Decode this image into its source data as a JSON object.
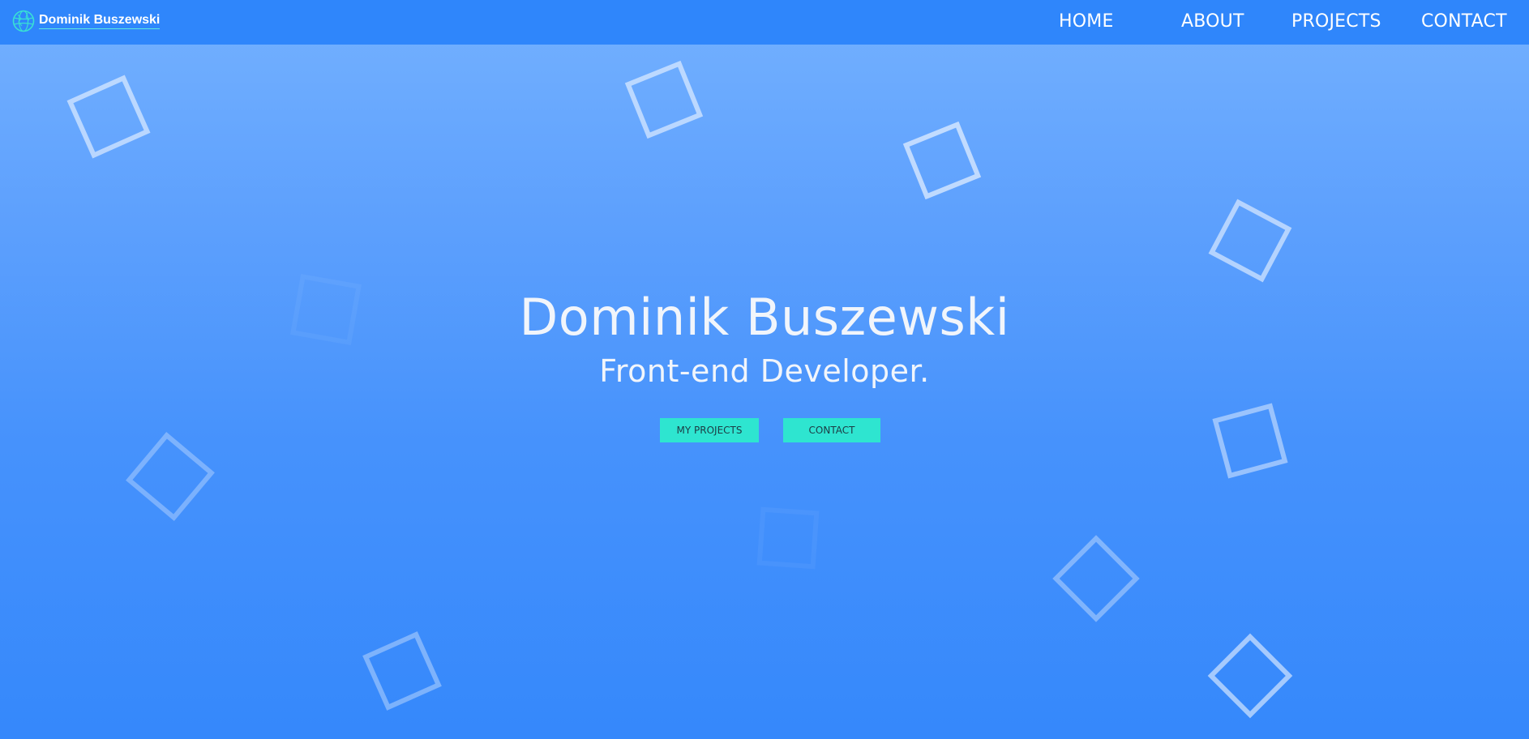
{
  "nav": {
    "brand_name": "Dominik Buszewski",
    "links": [
      {
        "label": "HOME"
      },
      {
        "label": "ABOUT"
      },
      {
        "label": "PROJECTS"
      },
      {
        "label": "CONTACT"
      }
    ]
  },
  "hero": {
    "title": "Dominik Buszewski",
    "subtitle": "Front-end Developer.",
    "buttons": [
      {
        "label": "MY PROJECTS"
      },
      {
        "label": "CONTACT"
      }
    ]
  },
  "colors": {
    "navbar": "#2f86fb",
    "background_top": "#74b1ff",
    "background_bottom": "#3588fb",
    "button": "#2ee5d0",
    "button_text": "#1d3b44",
    "text": "#f1f5fb"
  },
  "icons": {
    "brand": "globe-icon",
    "decorations": "square-outline-icon"
  }
}
